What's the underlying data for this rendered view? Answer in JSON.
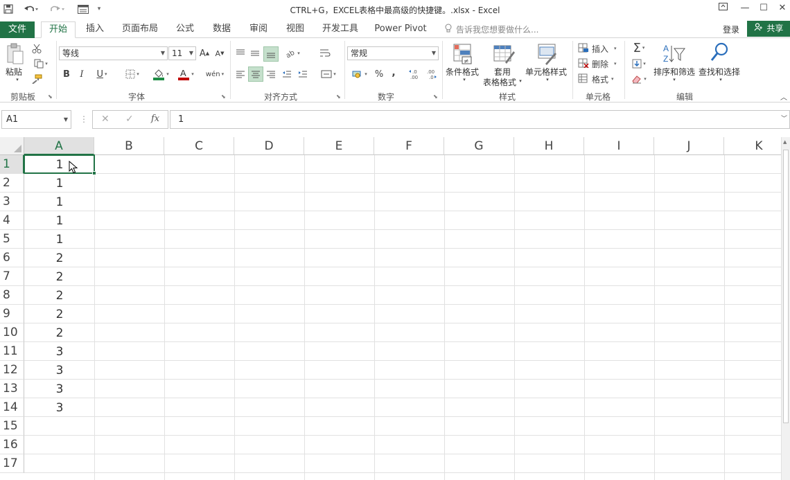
{
  "app": {
    "window_title": "CTRL+G，EXCEL表格中最高级的快捷键。.xlsx - Excel"
  },
  "tabs": {
    "file": "文件",
    "items": [
      "开始",
      "插入",
      "页面布局",
      "公式",
      "数据",
      "审阅",
      "视图",
      "开发工具",
      "Power Pivot"
    ],
    "tell_me": "告诉我您想要做什么...",
    "login": "登录",
    "share": "共享"
  },
  "ribbon": {
    "clipboard": {
      "paste": "粘贴",
      "group": "剪贴板"
    },
    "font": {
      "name": "等线",
      "size": "11",
      "grow": "A",
      "shrink": "A",
      "bold": "B",
      "italic": "I",
      "underline": "U",
      "fill_color": "#ffc000",
      "font_color": "#c00000",
      "wen": "wén",
      "group": "字体"
    },
    "alignment": {
      "group": "对齐方式"
    },
    "number": {
      "format": "常规",
      "percent": "%",
      "comma": ",",
      "inc_decimal": "←.0 .00",
      "dec_decimal": ".00 →.0",
      "group": "数字"
    },
    "styles": {
      "conditional": "条件格式",
      "table_format_1": "套用",
      "table_format_2": "表格格式",
      "cell_styles": "单元格样式",
      "group": "样式"
    },
    "cells": {
      "insert": "插入",
      "delete": "删除",
      "format": "格式",
      "group": "单元格"
    },
    "editing": {
      "sort_filter": "排序和筛选",
      "find_select": "查找和选择",
      "group": "编辑"
    }
  },
  "formula_bar": {
    "name_box": "A1",
    "cancel": "✕",
    "enter": "✓",
    "fx": "fx",
    "value": "1"
  },
  "sheet": {
    "columns": [
      "A",
      "B",
      "C",
      "D",
      "E",
      "F",
      "G",
      "H",
      "I",
      "J",
      "K"
    ],
    "rows": [
      "1",
      "2",
      "3",
      "4",
      "5",
      "6",
      "7",
      "8",
      "9",
      "10",
      "11",
      "12",
      "13",
      "14",
      "15",
      "16",
      "17"
    ],
    "column_a_values": [
      "1",
      "1",
      "1",
      "1",
      "1",
      "2",
      "2",
      "2",
      "2",
      "2",
      "3",
      "3",
      "3",
      "3",
      "",
      "",
      ""
    ],
    "selected_cell": "A1"
  },
  "colors": {
    "accent": "#217346",
    "header_selected": "#e1e1e1",
    "gridline": "#e1e1e1"
  }
}
